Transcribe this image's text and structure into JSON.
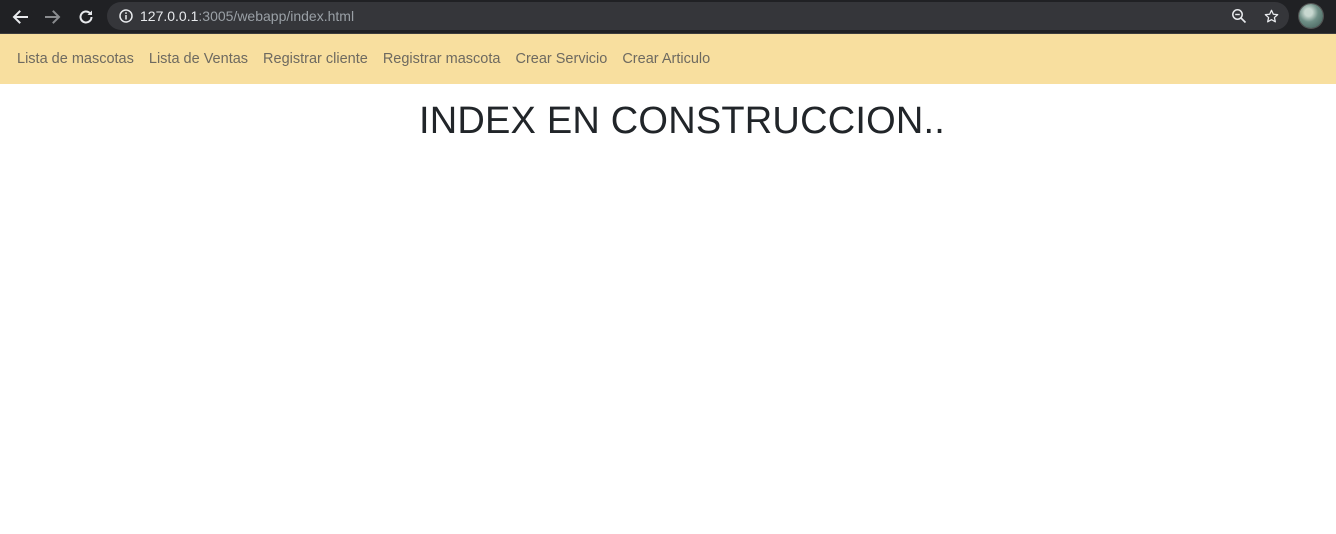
{
  "browser": {
    "url_host": "127.0.0.1",
    "url_path": ":3005/webapp/index.html",
    "icons": {
      "back": "arrow-left-icon",
      "forward": "arrow-right-icon",
      "reload": "reload-icon",
      "site_info": "info-circle-icon",
      "zoom": "zoom-out-icon",
      "bookmark": "star-icon",
      "profile": "avatar"
    },
    "colors": {
      "toolbar": "#202124",
      "omnibox": "#35363a"
    }
  },
  "navbar": {
    "background": "#f8df9f",
    "links": [
      {
        "label": "Lista de mascotas"
      },
      {
        "label": "Lista de Ventas"
      },
      {
        "label": "Registrar cliente"
      },
      {
        "label": "Registrar mascota"
      },
      {
        "label": "Crear Servicio"
      },
      {
        "label": "Crear Articulo"
      }
    ]
  },
  "main": {
    "title": "INDEX EN CONSTRUCCION.."
  }
}
